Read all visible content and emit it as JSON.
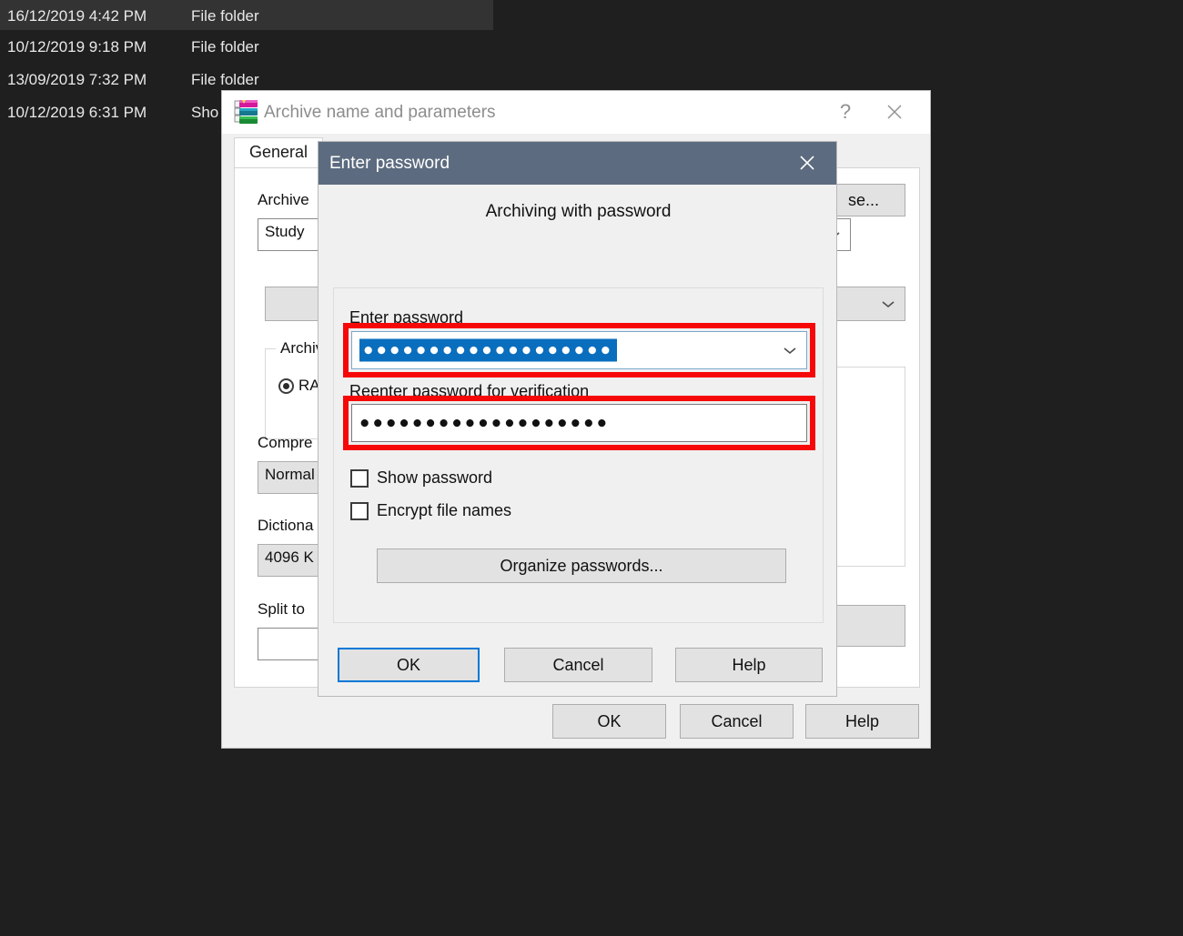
{
  "explorer": {
    "rows": [
      {
        "date": "16/12/2019 4:42 PM",
        "type": "File folder",
        "selected": true
      },
      {
        "date": "10/12/2019 9:18 PM",
        "type": "File folder",
        "selected": false
      },
      {
        "date": "13/09/2019 7:32 PM",
        "type": "File folder",
        "selected": false
      },
      {
        "date": "10/12/2019 6:31 PM",
        "type": "Sho",
        "selected": false
      }
    ]
  },
  "main_dialog": {
    "title": "Archive name and parameters",
    "icon": "winrar-books-icon",
    "help_glyph": "?",
    "close_glyph": "✕",
    "tab_label": "General",
    "archive_name_label": "Archive",
    "archive_name_value": "Study",
    "browse_label": "se...",
    "profiles_button_label": "",
    "format_group_label": "Archiv",
    "format_rar_label": "RA",
    "compression_label": "Compre",
    "compression_value": "Normal",
    "dictionary_label": "Dictiona",
    "dictionary_value": "4096 K",
    "split_label": "Split to",
    "split_value": "",
    "buttons": {
      "ok": "OK",
      "cancel": "Cancel",
      "help": "Help"
    }
  },
  "password_dialog": {
    "title": "Enter password",
    "close_glyph": "✕",
    "heading": "Archiving with password",
    "enter_password_label": "Enter password",
    "enter_password_dots": "●●●●●●●●●●●●●●●●●●●",
    "reenter_password_label": "Reenter password for verification",
    "reenter_password_dots": "●●●●●●●●●●●●●●●●●●●",
    "show_password_label": "Show password",
    "show_password_checked": false,
    "encrypt_file_names_label": "Encrypt file names",
    "encrypt_file_names_checked": false,
    "organize_passwords_label": "Organize passwords...",
    "buttons": {
      "ok": "OK",
      "cancel": "Cancel",
      "help": "Help"
    },
    "highlight_color": "#f60808",
    "titlebar_color": "#5c6b7f",
    "selection_color": "#0a6ebe",
    "focus_color": "#0078d7"
  }
}
